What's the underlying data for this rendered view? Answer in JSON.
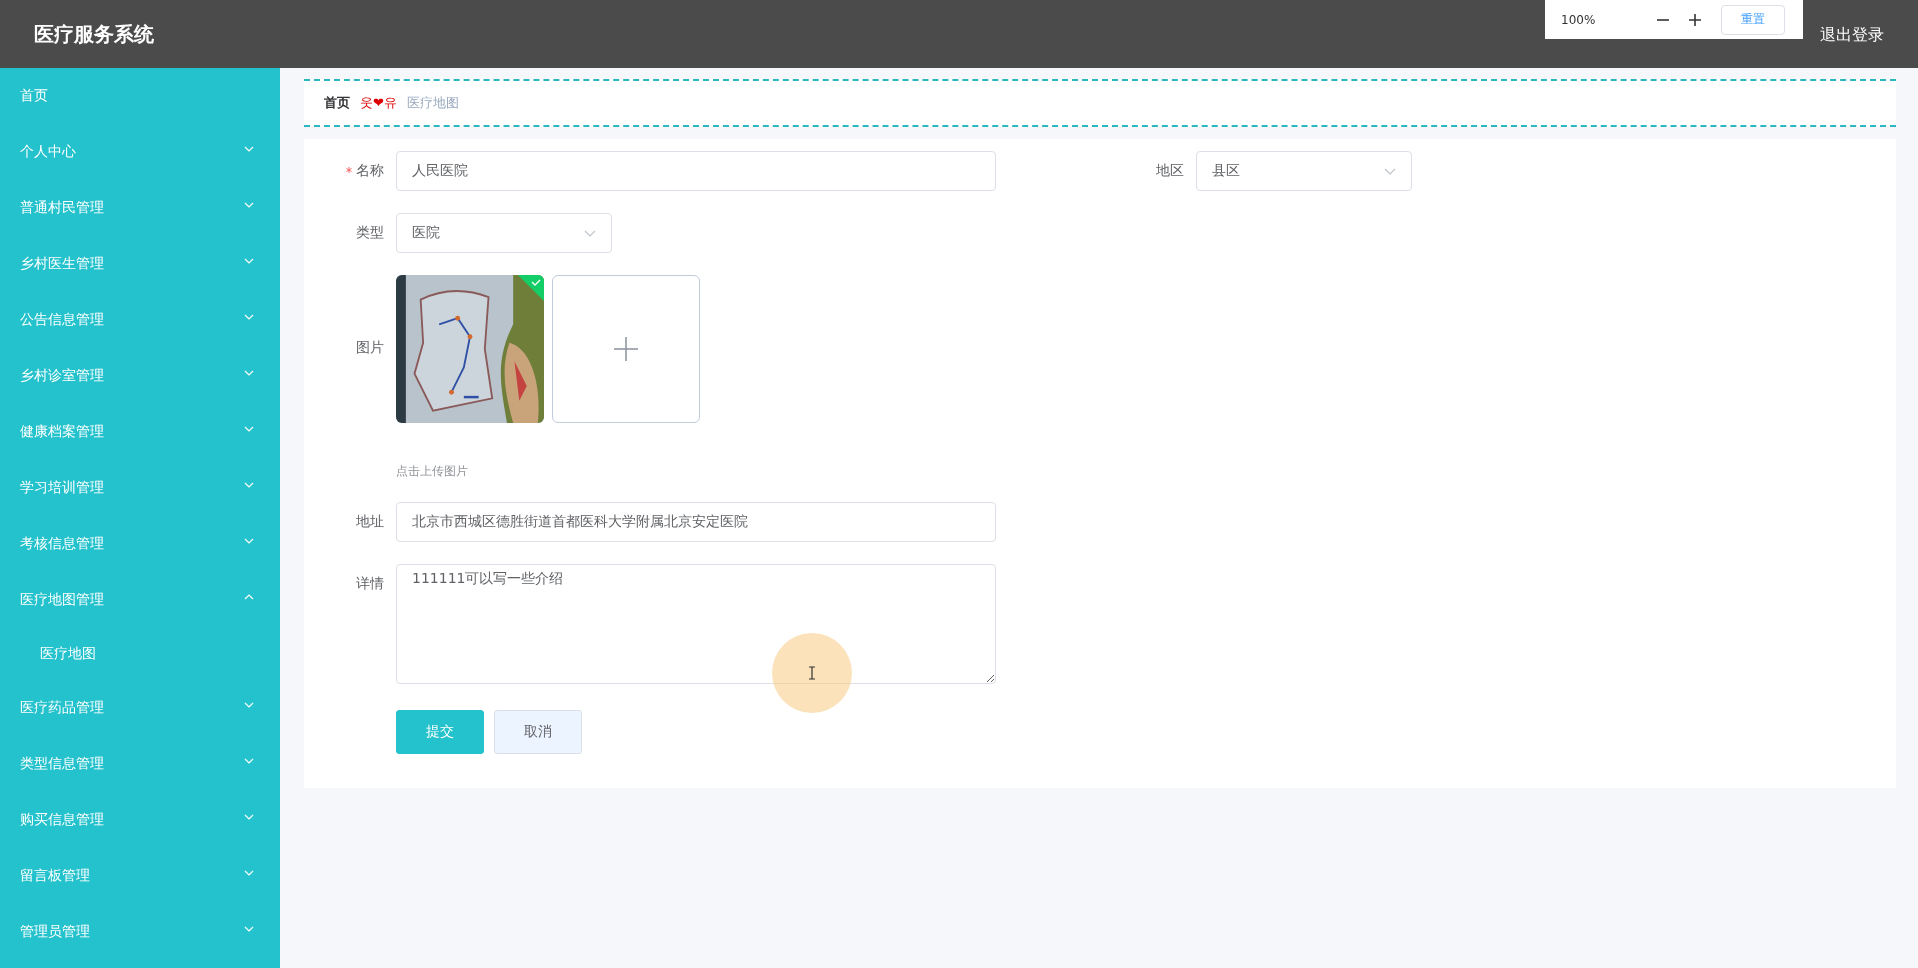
{
  "header": {
    "title": "医疗服务系统",
    "actions": [
      "退出登录"
    ]
  },
  "zoom_popup": {
    "value": "100%",
    "reset_button": "重置"
  },
  "sidebar": {
    "items": [
      {
        "label": "首页",
        "kind": "link"
      },
      {
        "label": "个人中心",
        "kind": "menu",
        "expanded": false
      },
      {
        "label": "普通村民管理",
        "kind": "menu",
        "expanded": false
      },
      {
        "label": "乡村医生管理",
        "kind": "menu",
        "expanded": false
      },
      {
        "label": "公告信息管理",
        "kind": "menu",
        "expanded": false
      },
      {
        "label": "乡村诊室管理",
        "kind": "menu",
        "expanded": false
      },
      {
        "label": "健康档案管理",
        "kind": "menu",
        "expanded": false
      },
      {
        "label": "学习培训管理",
        "kind": "menu",
        "expanded": false
      },
      {
        "label": "考核信息管理",
        "kind": "menu",
        "expanded": false
      },
      {
        "label": "医疗地图管理",
        "kind": "menu",
        "expanded": true,
        "children": [
          {
            "label": "医疗地图"
          }
        ]
      },
      {
        "label": "医疗药品管理",
        "kind": "menu",
        "expanded": false
      },
      {
        "label": "类型信息管理",
        "kind": "menu",
        "expanded": false
      },
      {
        "label": "购买信息管理",
        "kind": "menu",
        "expanded": false
      },
      {
        "label": "留言板管理",
        "kind": "menu",
        "expanded": false
      },
      {
        "label": "管理员管理",
        "kind": "menu",
        "expanded": false
      }
    ]
  },
  "breadcrumb": {
    "items": [
      "首页",
      "医疗地图"
    ],
    "separator": "웃❤유"
  },
  "form": {
    "rows": [
      [
        {
          "kind": "text",
          "label": "名称",
          "required": true,
          "value": "人民医院"
        },
        {
          "kind": "select",
          "label": "地区",
          "required": false,
          "value": "县区"
        }
      ],
      [
        {
          "kind": "select",
          "label": "类型",
          "required": false,
          "value": "医院"
        }
      ],
      [
        {
          "kind": "upload",
          "label": "图片",
          "required": false,
          "images": [
            {
              "kind": "picture",
              "success": true
            }
          ],
          "hint": "点击上传图片"
        }
      ],
      [
        {
          "kind": "text",
          "label": "地址",
          "required": false,
          "value": "北京市西城区德胜街道首都医科大学附属北京安定医院"
        }
      ],
      [
        {
          "kind": "textarea",
          "label": "详情",
          "required": false,
          "value": "111111可以写一些介绍"
        }
      ]
    ],
    "buttons": [
      {
        "label": "提交",
        "kind": "primary"
      },
      {
        "label": "取消",
        "kind": "default"
      }
    ]
  }
}
